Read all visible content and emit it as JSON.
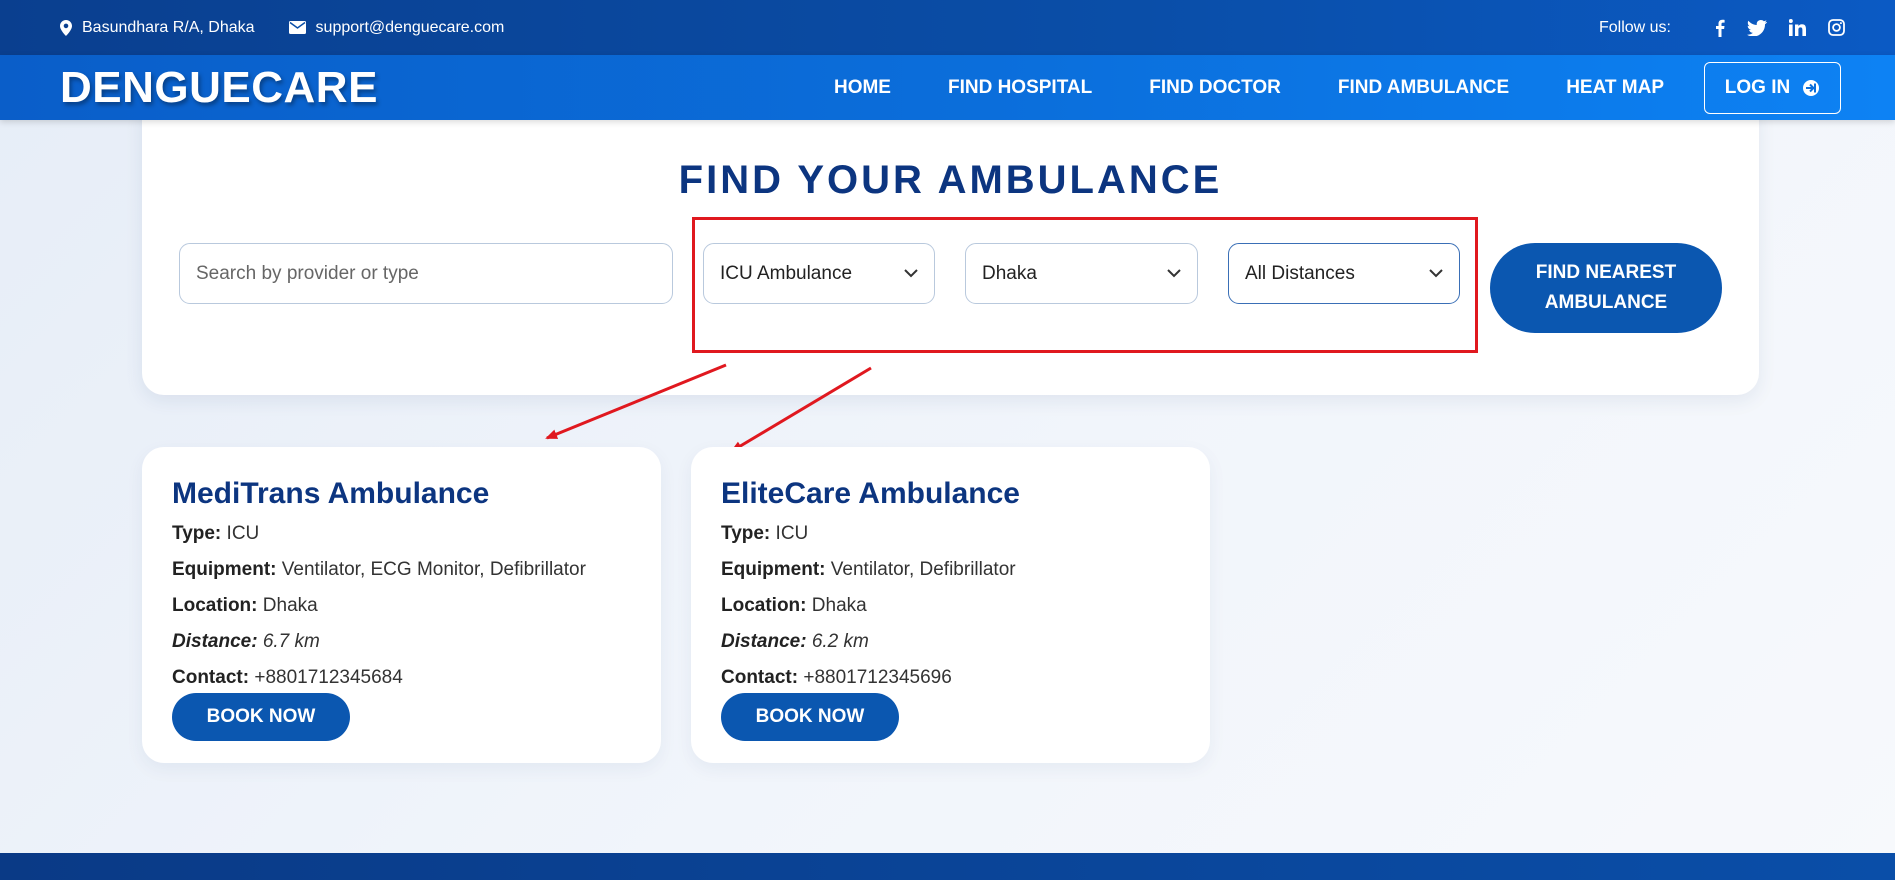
{
  "topbar": {
    "address": "Basundhara R/A, Dhaka",
    "email": "support@denguecare.com",
    "follow_label": "Follow us:",
    "social_icons": [
      "facebook-icon",
      "twitter-icon",
      "linkedin-icon",
      "instagram-icon"
    ]
  },
  "nav": {
    "brand": "DENGUECARE",
    "items": [
      "HOME",
      "FIND HOSPITAL",
      "FIND DOCTOR",
      "FIND AMBULANCE",
      "HEAT MAP"
    ],
    "login_label": "LOG IN"
  },
  "search_panel": {
    "title": "FIND YOUR AMBULANCE",
    "search_placeholder": "Search by provider or type",
    "type_select": "ICU Ambulance",
    "location_select": "Dhaka",
    "distance_select": "All Distances",
    "find_button_line1": "FIND NEAREST",
    "find_button_line2": "AMBULANCE"
  },
  "results": [
    {
      "name": "MediTrans Ambulance",
      "type_label": "Type:",
      "type": "ICU",
      "equipment_label": "Equipment:",
      "equipment": "Ventilator, ECG Monitor, Defibrillator",
      "location_label": "Location:",
      "location": "Dhaka",
      "distance_label": "Distance:",
      "distance": "6.7 km",
      "contact_label": "Contact:",
      "contact": "+8801712345684",
      "book_label": "BOOK NOW"
    },
    {
      "name": "EliteCare Ambulance",
      "type_label": "Type:",
      "type": "ICU",
      "equipment_label": "Equipment:",
      "equipment": "Ventilator, Defibrillator",
      "location_label": "Location:",
      "location": "Dhaka",
      "distance_label": "Distance:",
      "distance": "6.2 km",
      "contact_label": "Contact:",
      "contact": "+8801712345696",
      "book_label": "BOOK NOW"
    }
  ],
  "colors": {
    "brand_dark": "#0c3580",
    "button_blue": "#0b57b0",
    "annotation_red": "#e0181f"
  }
}
